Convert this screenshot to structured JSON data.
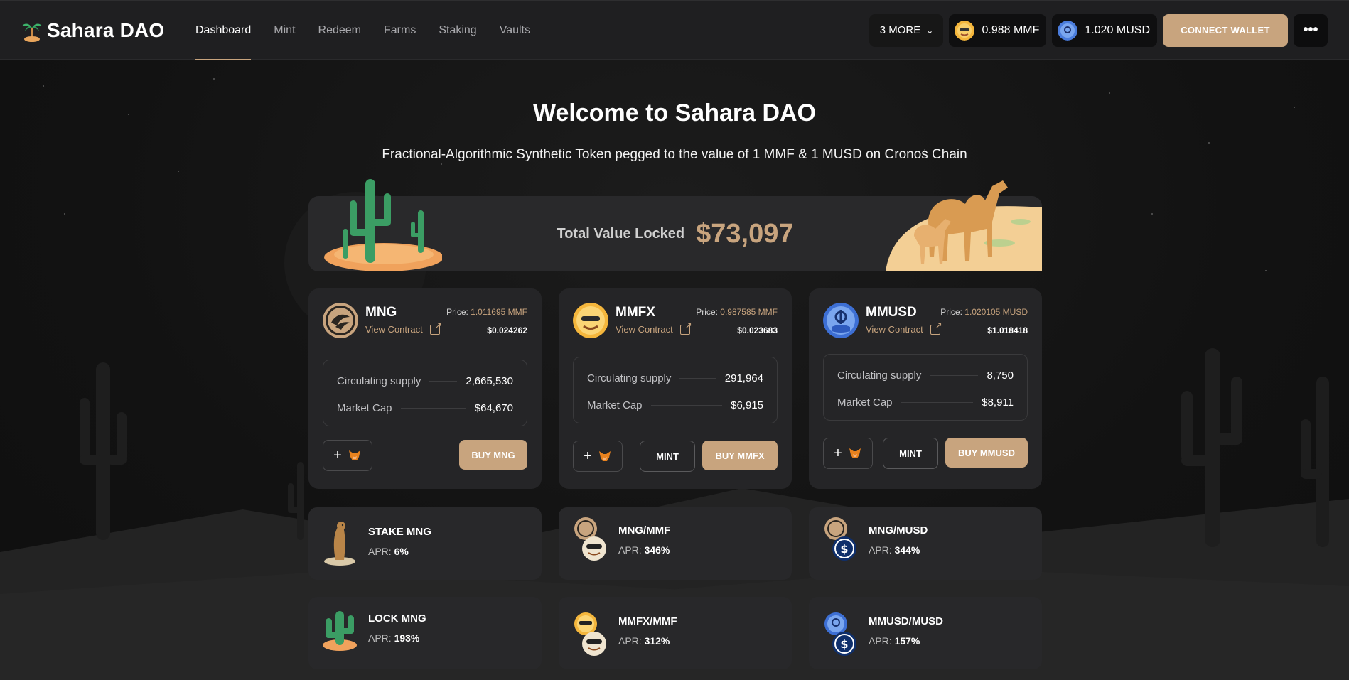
{
  "brand": {
    "name": "Sahara DAO"
  },
  "nav": [
    {
      "label": "Dashboard",
      "active": true
    },
    {
      "label": "Mint"
    },
    {
      "label": "Redeem"
    },
    {
      "label": "Farms"
    },
    {
      "label": "Staking"
    },
    {
      "label": "Vaults"
    }
  ],
  "header": {
    "more_label": "3 MORE",
    "mmf_price": "0.988 MMF",
    "musd_price": "1.020 MUSD",
    "connect_label": "CONNECT WALLET",
    "menu_label": "•••"
  },
  "hero": {
    "title": "Welcome to Sahara DAO",
    "subtitle": "Fractional-Algorithmic Synthetic Token pegged to the value of 1 MMF & 1 MUSD on Cronos Chain"
  },
  "tvl": {
    "label": "Total Value Locked",
    "value": "$73,097"
  },
  "tokens": [
    {
      "name": "MNG",
      "view_contract": "View Contract",
      "price_label": "Price: ",
      "price_value": "1.011695 MMF",
      "usd": "$0.024262",
      "supply_label": "Circulating supply",
      "supply": "2,665,530",
      "mcap_label": "Market Cap",
      "mcap": "$64,670",
      "add_label": "+",
      "buy_label": "BUY MNG"
    },
    {
      "name": "MMFX",
      "view_contract": "View Contract",
      "price_label": "Price: ",
      "price_value": "0.987585 MMF",
      "usd": "$0.023683",
      "supply_label": "Circulating supply",
      "supply": "291,964",
      "mcap_label": "Market Cap",
      "mcap": "$6,915",
      "add_label": "+",
      "mint_label": "MINT",
      "buy_label": "BUY MMFX"
    },
    {
      "name": "MMUSD",
      "view_contract": "View Contract",
      "price_label": "Price: ",
      "price_value": "1.020105 MUSD",
      "usd": "$1.018418",
      "supply_label": "Circulating supply",
      "supply": "8,750",
      "mcap_label": "Market Cap",
      "mcap": "$8,911",
      "add_label": "+",
      "mint_label": "MINT",
      "buy_label": "BUY MMUSD"
    }
  ],
  "farms": [
    {
      "title": "STAKE MNG",
      "apr_label": "APR: ",
      "apr": "6%"
    },
    {
      "title": "MNG/MMF",
      "apr_label": "APR: ",
      "apr": "346%"
    },
    {
      "title": "MNG/MUSD",
      "apr_label": "APR: ",
      "apr": "344%"
    },
    {
      "title": "LOCK MNG",
      "apr_label": "APR: ",
      "apr": "193%"
    },
    {
      "title": "MMFX/MMF",
      "apr_label": "APR: ",
      "apr": "312%"
    },
    {
      "title": "MMUSD/MUSD",
      "apr_label": "APR: ",
      "apr": "157%"
    }
  ],
  "colors": {
    "accent": "#c8a47e",
    "card": "#252527",
    "header": "#1f1f21"
  },
  "icons": {
    "brand": "palm-tree-icon",
    "chevron": "chevron-down-icon",
    "external": "external-link-icon",
    "wallet": "metamask-fox-icon"
  }
}
